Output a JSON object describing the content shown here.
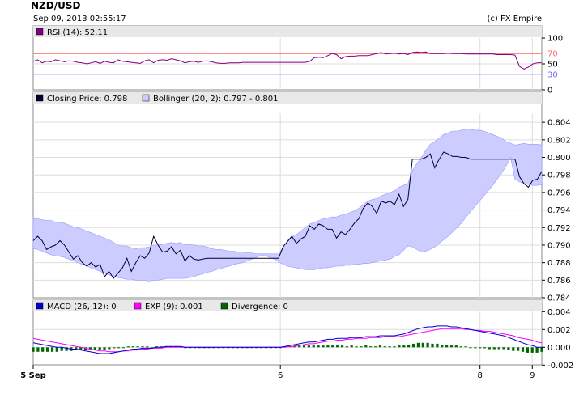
{
  "header": {
    "symbol": "NZD/USD",
    "timestamp": "Sep 09, 2013 02:55:17",
    "credit": "(c) FX Empire"
  },
  "colors": {
    "rsi_line": "#800080",
    "rsi_overbought_fill": "#ff6666",
    "rsi_upper_line": "#ff6666",
    "rsi_lower_line": "#6666ff",
    "close_line": "#000033",
    "bollinger_fill": "#ccccff",
    "bollinger_edge": "#9999ff",
    "macd_line": "#0000cc",
    "exp_line": "#ff00ff",
    "divergence_bar": "#006600",
    "legend_bg": "#e8e8e8",
    "grid": "#dddddd"
  },
  "chart_data": [
    {
      "type": "line",
      "panel": "rsi",
      "legend": "RSI (14): 52.11",
      "ylim": [
        0,
        100
      ],
      "yticks": [
        0,
        50,
        100
      ],
      "reference_levels": [
        30,
        70
      ],
      "series": [
        {
          "name": "RSI (14)",
          "values": [
            55,
            58,
            52,
            55,
            54,
            58,
            56,
            54,
            56,
            55,
            53,
            52,
            50,
            52,
            54,
            51,
            55,
            53,
            52,
            58,
            55,
            54,
            53,
            52,
            51,
            56,
            58,
            52,
            57,
            58,
            57,
            60,
            58,
            56,
            52,
            54,
            55,
            53,
            55,
            56,
            54,
            52,
            51,
            51,
            52,
            52,
            52,
            53,
            53,
            53,
            53,
            53,
            53,
            53,
            53,
            53,
            53,
            53,
            53,
            53,
            53,
            53,
            55,
            62,
            63,
            62,
            66,
            70,
            68,
            60,
            64,
            65,
            65,
            66,
            66,
            66,
            68,
            70,
            72,
            69,
            70,
            71,
            69,
            70,
            68,
            72,
            73,
            72,
            73,
            70,
            70,
            70,
            70,
            71,
            70,
            70,
            70,
            69,
            69,
            69,
            69,
            69,
            69,
            69,
            68,
            68,
            68,
            68,
            67,
            45,
            40,
            44,
            50,
            52,
            52.11
          ]
        }
      ]
    },
    {
      "type": "line",
      "panel": "price",
      "legend": [
        "Closing Price: 0.798",
        "Bollinger (20, 2): 0.797 - 0.801"
      ],
      "ylim": [
        0.784,
        0.805
      ],
      "yticks": [
        0.784,
        0.786,
        0.788,
        0.79,
        0.792,
        0.794,
        0.796,
        0.798,
        0.8,
        0.802,
        0.804
      ],
      "series": [
        {
          "name": "Closing Price",
          "values": [
            0.7905,
            0.791,
            0.7905,
            0.7895,
            0.7898,
            0.79,
            0.7905,
            0.79,
            0.7892,
            0.7884,
            0.7888,
            0.788,
            0.7876,
            0.788,
            0.7875,
            0.7878,
            0.7864,
            0.787,
            0.7862,
            0.7868,
            0.7874,
            0.7885,
            0.787,
            0.788,
            0.7888,
            0.7885,
            0.7891,
            0.791,
            0.79,
            0.7892,
            0.7893,
            0.7898,
            0.789,
            0.7894,
            0.7882,
            0.7888,
            0.7884,
            0.7883,
            0.7884,
            0.7885,
            0.7885,
            0.7885,
            0.7885,
            0.7885,
            0.7885,
            0.7885,
            0.7885,
            0.7885,
            0.7885,
            0.7885,
            0.7885,
            0.7885,
            0.7885,
            0.7885,
            0.7885,
            0.7885,
            0.7898,
            0.7904,
            0.791,
            0.7902,
            0.7907,
            0.791,
            0.7922,
            0.7918,
            0.7924,
            0.7922,
            0.7918,
            0.7918,
            0.7908,
            0.7915,
            0.7912,
            0.7918,
            0.7925,
            0.793,
            0.7942,
            0.7948,
            0.7944,
            0.7936,
            0.795,
            0.7948,
            0.795,
            0.7946,
            0.7958,
            0.7944,
            0.7952,
            0.7998,
            0.7998,
            0.7998,
            0.8,
            0.8004,
            0.7988,
            0.7998,
            0.8006,
            0.8004,
            0.8001,
            0.8001,
            0.8,
            0.8,
            0.7998,
            0.7998,
            0.7998,
            0.7998,
            0.7998,
            0.7998,
            0.7998,
            0.7998,
            0.7998,
            0.7998,
            0.7998,
            0.7978,
            0.797,
            0.7966,
            0.7974,
            0.7975,
            0.7984
          ]
        },
        {
          "name": "Bollinger upper",
          "values": [
            0.793,
            0.793,
            0.7929,
            0.7928,
            0.7928,
            0.7926,
            0.7926,
            0.7925,
            0.7923,
            0.7921,
            0.792,
            0.7918,
            0.7916,
            0.7914,
            0.7912,
            0.791,
            0.7908,
            0.7906,
            0.7903,
            0.79,
            0.7899,
            0.7899,
            0.7897,
            0.7896,
            0.7897,
            0.7897,
            0.7898,
            0.79,
            0.79,
            0.7901,
            0.7902,
            0.7903,
            0.7902,
            0.7903,
            0.79,
            0.7901,
            0.79,
            0.7899,
            0.7899,
            0.7898,
            0.7896,
            0.7895,
            0.7895,
            0.7894,
            0.7893,
            0.7893,
            0.7892,
            0.7892,
            0.7891,
            0.7891,
            0.789,
            0.789,
            0.789,
            0.789,
            0.789,
            0.789,
            0.7897,
            0.7905,
            0.7911,
            0.7912,
            0.7916,
            0.792,
            0.7924,
            0.7926,
            0.7928,
            0.793,
            0.7931,
            0.7932,
            0.7932,
            0.7934,
            0.7935,
            0.7937,
            0.7939,
            0.7942,
            0.7946,
            0.795,
            0.7952,
            0.7953,
            0.7956,
            0.7958,
            0.796,
            0.7962,
            0.7966,
            0.7968,
            0.797,
            0.7985,
            0.7993,
            0.8,
            0.8008,
            0.8015,
            0.8018,
            0.8022,
            0.8026,
            0.8028,
            0.803,
            0.803,
            0.8031,
            0.8032,
            0.8032,
            0.8031,
            0.8031,
            0.803,
            0.8028,
            0.8026,
            0.8024,
            0.8022,
            0.8018,
            0.8016,
            0.8014,
            0.8015,
            0.8016,
            0.8015,
            0.8015,
            0.8015,
            0.8014
          ]
        },
        {
          "name": "Bollinger lower",
          "values": [
            0.7896,
            0.7895,
            0.7893,
            0.7891,
            0.7889,
            0.7888,
            0.7887,
            0.7886,
            0.7884,
            0.7882,
            0.788,
            0.7878,
            0.7876,
            0.7874,
            0.7872,
            0.787,
            0.7868,
            0.7866,
            0.7864,
            0.7863,
            0.7862,
            0.7861,
            0.7861,
            0.786,
            0.786,
            0.786,
            0.7859,
            0.786,
            0.786,
            0.7861,
            0.7862,
            0.7862,
            0.7862,
            0.7862,
            0.7862,
            0.7863,
            0.7864,
            0.7866,
            0.7867,
            0.7869,
            0.787,
            0.7872,
            0.7873,
            0.7875,
            0.7876,
            0.7878,
            0.7879,
            0.788,
            0.7882,
            0.7884,
            0.7886,
            0.7888,
            0.7888,
            0.7886,
            0.7884,
            0.7881,
            0.7878,
            0.7876,
            0.7875,
            0.7874,
            0.7873,
            0.7872,
            0.7872,
            0.7872,
            0.7873,
            0.7874,
            0.7874,
            0.7875,
            0.7876,
            0.7876,
            0.7877,
            0.7877,
            0.7878,
            0.7878,
            0.7879,
            0.7879,
            0.788,
            0.7881,
            0.7882,
            0.7883,
            0.7884,
            0.7887,
            0.7889,
            0.7894,
            0.7899,
            0.7898,
            0.7895,
            0.7892,
            0.7893,
            0.7895,
            0.7898,
            0.7902,
            0.7906,
            0.791,
            0.7915,
            0.792,
            0.7925,
            0.7932,
            0.7938,
            0.7944,
            0.795,
            0.7956,
            0.7962,
            0.7968,
            0.7975,
            0.7982,
            0.799,
            0.8,
            0.7975,
            0.7972,
            0.797,
            0.7969,
            0.7968,
            0.7968,
            0.7969
          ]
        }
      ]
    },
    {
      "type": "line",
      "panel": "macd",
      "legend": [
        "MACD (26, 12): 0",
        "EXP (9): 0.001",
        "Divergence: 0"
      ],
      "ylim": [
        -0.002,
        0.004
      ],
      "yticks": [
        -0.002,
        0.0,
        0.002,
        0.004
      ],
      "x_tick_labels": [
        "5 Sep",
        "6",
        "8",
        "9"
      ],
      "x_tick_indices": [
        0,
        52,
        94,
        105
      ],
      "series": [
        {
          "name": "MACD (26, 12)",
          "values": [
            0.0005,
            0.0004,
            0.0003,
            0.0002,
            0.0001,
            0.0,
            0.0,
            -0.0001,
            -0.0002,
            -0.0002,
            -0.0003,
            -0.0004,
            -0.0005,
            -0.0006,
            -0.0007,
            -0.0007,
            -0.0007,
            -0.0006,
            -0.0005,
            -0.0004,
            -0.0003,
            -0.0002,
            -0.0002,
            -0.0001,
            -0.0001,
            -0.0001,
            0.0,
            0.0,
            0.0001,
            0.0001,
            0.0001,
            0.0001,
            0.0,
            0.0,
            0.0,
            0.0,
            0.0,
            0.0,
            0.0,
            0.0,
            0.0,
            0.0,
            0.0,
            0.0,
            0.0,
            0.0,
            0.0,
            0.0,
            0.0,
            0.0,
            0.0,
            0.0,
            0.0,
            0.0001,
            0.0002,
            0.0003,
            0.0004,
            0.0005,
            0.0006,
            0.0006,
            0.0007,
            0.0008,
            0.0009,
            0.0009,
            0.001,
            0.001,
            0.001,
            0.0011,
            0.0011,
            0.0011,
            0.0012,
            0.0012,
            0.0012,
            0.0013,
            0.0013,
            0.0013,
            0.0013,
            0.0014,
            0.0015,
            0.0017,
            0.0019,
            0.0021,
            0.0022,
            0.0023,
            0.0023,
            0.0024,
            0.0024,
            0.0024,
            0.0023,
            0.0023,
            0.0022,
            0.0021,
            0.002,
            0.0019,
            0.0018,
            0.0017,
            0.0016,
            0.0015,
            0.0014,
            0.0013,
            0.0011,
            0.0009,
            0.0007,
            0.0005,
            0.0003,
            0.0002,
            0.0,
            0.0
          ]
        },
        {
          "name": "EXP (9)",
          "values": [
            0.001,
            0.0009,
            0.0008,
            0.0007,
            0.0006,
            0.0005,
            0.0004,
            0.0003,
            0.0002,
            0.0001,
            0.0,
            -0.0001,
            -0.0002,
            -0.0003,
            -0.0004,
            -0.0004,
            -0.0005,
            -0.0005,
            -0.0005,
            -0.0004,
            -0.0004,
            -0.0003,
            -0.0003,
            -0.0002,
            -0.0002,
            -0.0001,
            -0.0001,
            -0.0001,
            0.0,
            0.0,
            0.0,
            0.0,
            0.0,
            0.0,
            0.0,
            0.0,
            0.0,
            0.0,
            0.0,
            0.0,
            0.0,
            0.0,
            0.0,
            0.0,
            0.0,
            0.0,
            0.0,
            0.0,
            0.0,
            0.0,
            0.0,
            0.0,
            0.0,
            0.0,
            0.0001,
            0.0001,
            0.0002,
            0.0003,
            0.0004,
            0.0004,
            0.0005,
            0.0006,
            0.0007,
            0.0007,
            0.0008,
            0.0008,
            0.0009,
            0.0009,
            0.001,
            0.001,
            0.001,
            0.0011,
            0.0011,
            0.0011,
            0.0012,
            0.0012,
            0.0012,
            0.0012,
            0.0013,
            0.0014,
            0.0015,
            0.0016,
            0.0017,
            0.0018,
            0.0019,
            0.002,
            0.0021,
            0.0021,
            0.0021,
            0.0021,
            0.0021,
            0.002,
            0.002,
            0.0019,
            0.0019,
            0.0018,
            0.0018,
            0.0017,
            0.0016,
            0.0015,
            0.0014,
            0.0013,
            0.0011,
            0.001,
            0.0009,
            0.0008,
            0.0006,
            0.0005
          ]
        },
        {
          "name": "Divergence",
          "values": [
            -0.0005,
            -0.0005,
            -0.0005,
            -0.0005,
            -0.0005,
            -0.0005,
            -0.0004,
            -0.0004,
            -0.0004,
            -0.0003,
            -0.0003,
            -0.0003,
            -0.0003,
            -0.0003,
            -0.0003,
            -0.0003,
            -0.0002,
            -0.0001,
            0.0,
            0.0,
            0.0001,
            0.0001,
            0.0001,
            0.0001,
            0.0001,
            0.0,
            0.0001,
            0.0001,
            0.0001,
            0.0001,
            0.0001,
            0.0001,
            0.0,
            0.0,
            0.0,
            0.0,
            0.0,
            0.0,
            0.0,
            0.0,
            0.0,
            0.0,
            0.0,
            0.0,
            0.0,
            0.0,
            0.0,
            0.0,
            0.0,
            0.0,
            0.0,
            0.0,
            0.0,
            0.0001,
            0.0001,
            0.0002,
            0.0002,
            0.0002,
            0.0002,
            0.0002,
            0.0002,
            0.0002,
            0.0002,
            0.0002,
            0.0002,
            0.0002,
            0.0001,
            0.0002,
            0.0001,
            0.0001,
            0.0002,
            0.0001,
            0.0001,
            0.0002,
            0.0001,
            0.0001,
            0.0001,
            0.0002,
            0.0002,
            0.0003,
            0.0004,
            0.0005,
            0.0005,
            0.0005,
            0.0004,
            0.0004,
            0.0003,
            0.0003,
            0.0002,
            0.0002,
            0.0001,
            0.0001,
            0.0,
            0.0,
            -0.0001,
            -0.0001,
            -0.0002,
            -0.0002,
            -0.0002,
            -0.0002,
            -0.0003,
            -0.0004,
            -0.0004,
            -0.0005,
            -0.0006,
            -0.0006,
            -0.0006,
            -0.0005
          ]
        }
      ]
    }
  ]
}
